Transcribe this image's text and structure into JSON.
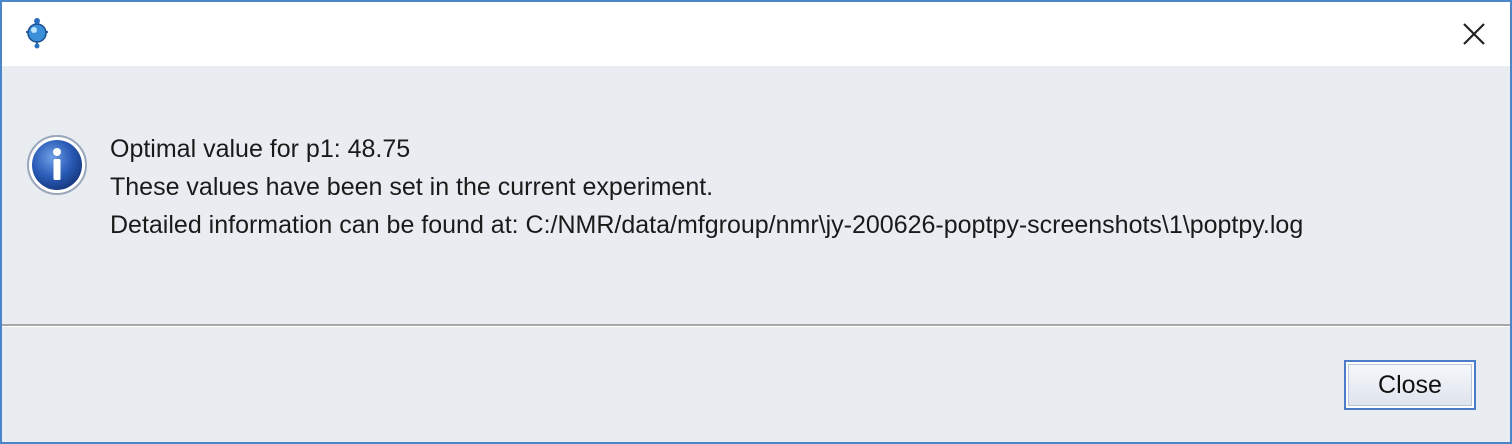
{
  "window": {
    "icon": "app-molecule-icon",
    "close_icon": "close-icon"
  },
  "dialog": {
    "icon": "information-icon",
    "lines": [
      "Optimal value for p1: 48.75",
      "These values have been set in the current experiment.",
      "Detailed information can be found at: C:/NMR/data/mfgroup/nmr\\jy-200626-poptpy-screenshots\\1\\poptpy.log"
    ]
  },
  "buttons": {
    "close_label": "Close"
  },
  "colors": {
    "window_border": "#4a86c8",
    "dialog_background": "#e9edf2",
    "button_focus_border": "#4a7cc7",
    "info_icon_blue": "#1f4fa3"
  }
}
